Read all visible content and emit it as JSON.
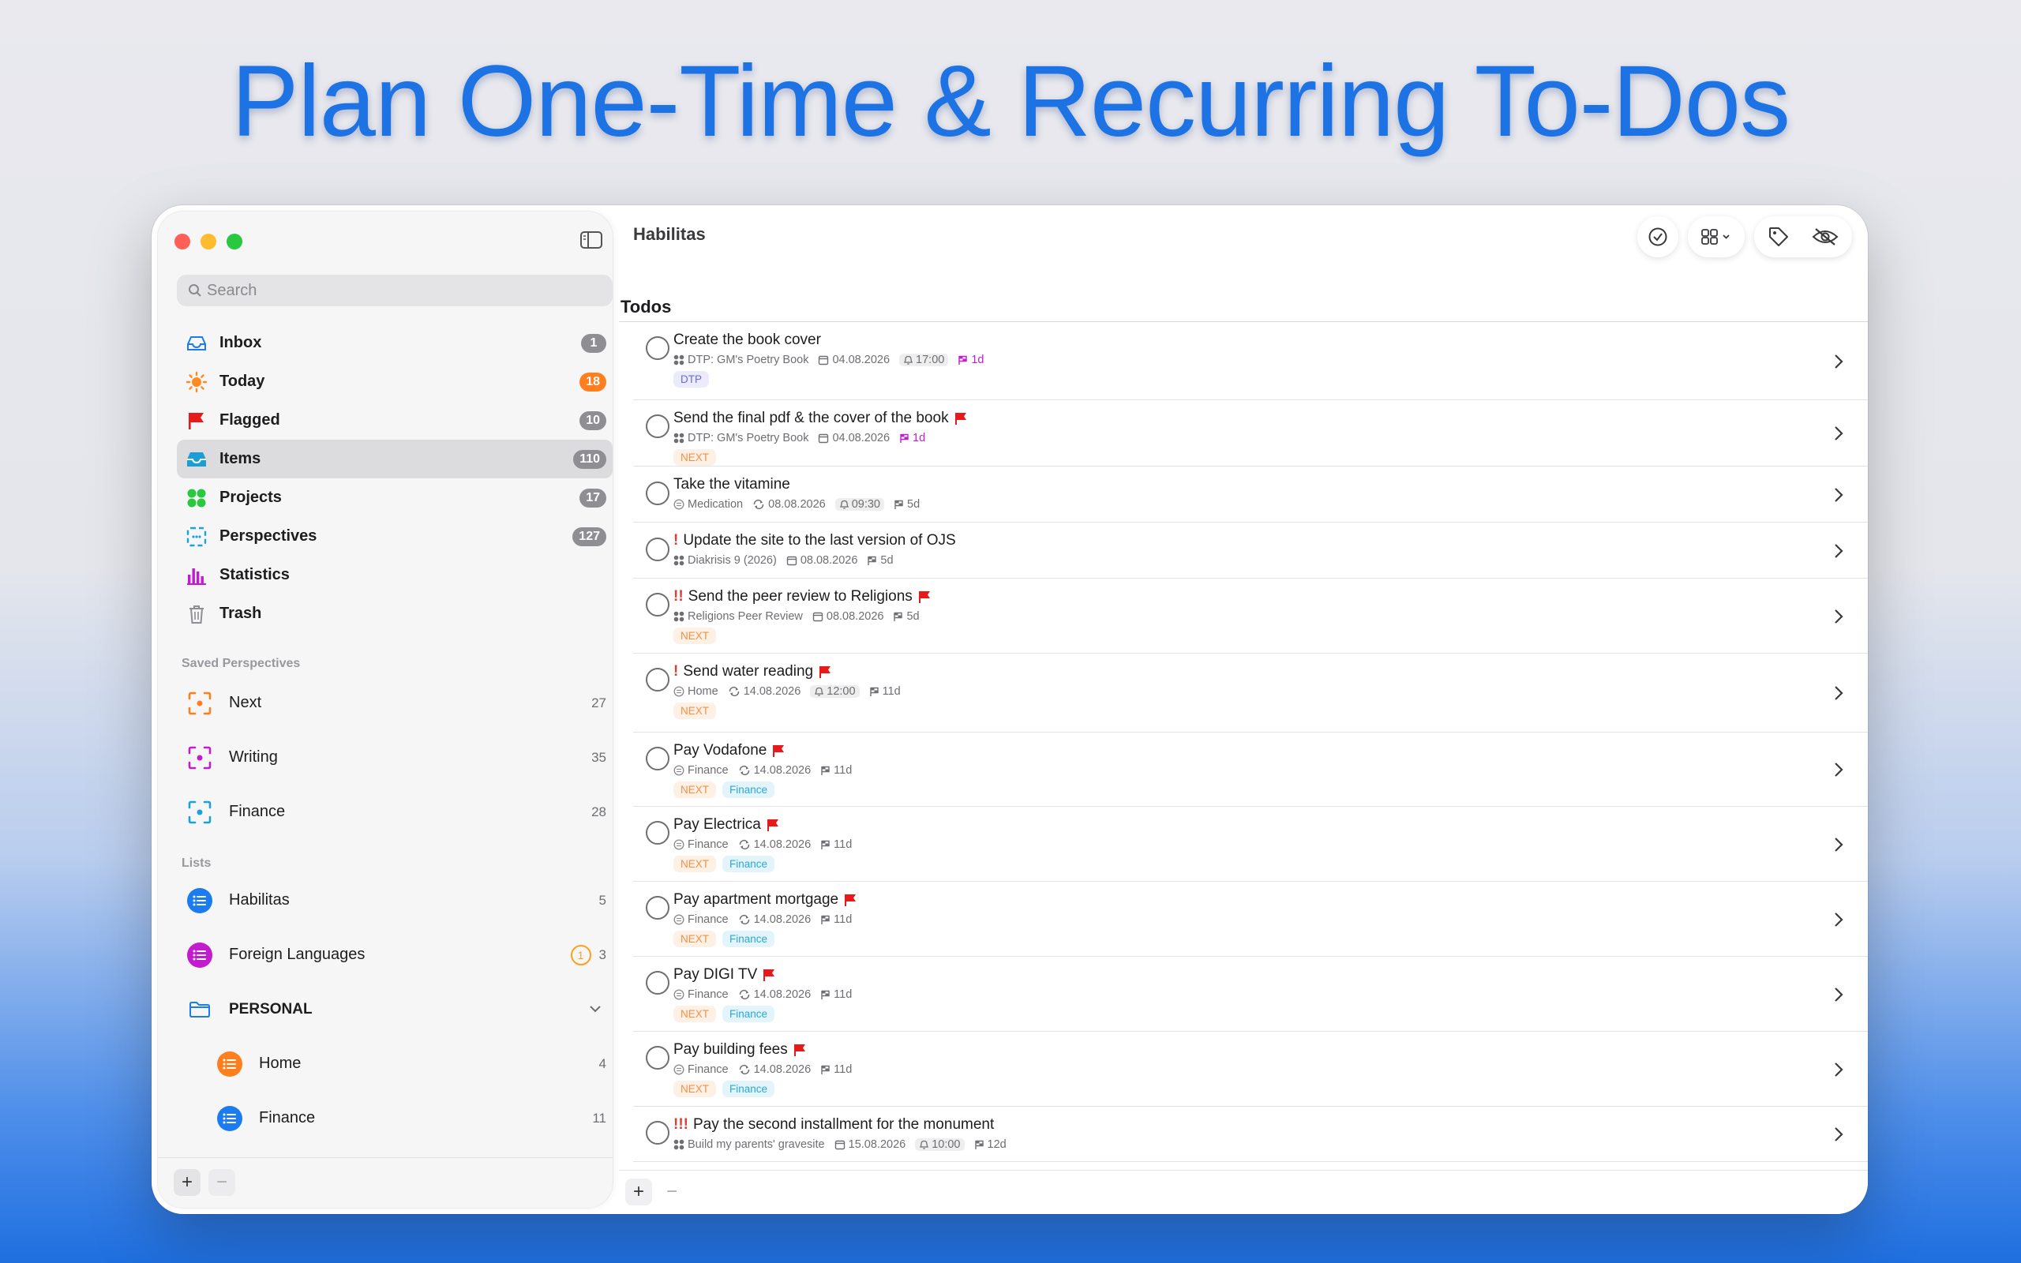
{
  "headline": "Plan One-Time & Recurring To-Dos",
  "sidebar": {
    "search_placeholder": "Search",
    "nav": [
      {
        "label": "Inbox",
        "count": "1"
      },
      {
        "label": "Today",
        "count": "18"
      },
      {
        "label": "Flagged",
        "count": "10"
      },
      {
        "label": "Items",
        "count": "110"
      },
      {
        "label": "Projects",
        "count": "17"
      },
      {
        "label": "Perspectives",
        "count": "127"
      },
      {
        "label": "Statistics"
      },
      {
        "label": "Trash"
      }
    ],
    "saved_title": "Saved Perspectives",
    "saved": [
      {
        "label": "Next",
        "count": "27",
        "color": "#ff7f1f"
      },
      {
        "label": "Writing",
        "count": "35",
        "color": "#c21bd0"
      },
      {
        "label": "Finance",
        "count": "28",
        "color": "#19a3d8"
      }
    ],
    "lists_title": "Lists",
    "lists": [
      {
        "label": "Habilitas",
        "count": "5",
        "color": "#1a7cf0"
      },
      {
        "label": "Foreign Languages",
        "count": "3",
        "alert": "1",
        "color": "#c21bd0"
      }
    ],
    "folder": {
      "label": "PERSONAL"
    },
    "sublists": [
      {
        "label": "Home",
        "count": "4",
        "color": "#ff7f1f"
      },
      {
        "label": "Finance",
        "count": "11",
        "color": "#1a7cf0"
      }
    ]
  },
  "main": {
    "title": "Habilitas",
    "section": "Todos",
    "tasks": [
      {
        "prio": "",
        "title": "Create the book cover",
        "flag": false,
        "project": "DTP: GM's Poetry Book",
        "ptype": "project",
        "date": "04.08.2026",
        "dtype": "cal",
        "time": "17:00",
        "due": "1d",
        "due_mag": true,
        "tags": [
          {
            "t": "DTP",
            "c": "dtp"
          }
        ]
      },
      {
        "prio": "",
        "title": "Send the final pdf & the cover of the book",
        "flag": true,
        "project": "DTP: GM's Poetry Book",
        "ptype": "project",
        "date": "04.08.2026",
        "dtype": "cal",
        "due": "1d",
        "due_mag": true,
        "tags": [
          {
            "t": "NEXT",
            "c": "next"
          }
        ]
      },
      {
        "prio": "",
        "title": "Take the vitamine",
        "flag": false,
        "project": "Medication",
        "ptype": "area",
        "date": "08.08.2026",
        "dtype": "rep",
        "time": "09:30",
        "due": "5d",
        "tags": []
      },
      {
        "prio": "!",
        "title": "Update the site to the last version of OJS",
        "flag": false,
        "project": "Diakrisis 9 (2026)",
        "ptype": "project",
        "date": "08.08.2026",
        "dtype": "cal",
        "due": "5d",
        "tags": []
      },
      {
        "prio": "!!",
        "title": "Send the peer review to Religions",
        "flag": true,
        "project": "Religions Peer Review",
        "ptype": "project",
        "date": "08.08.2026",
        "dtype": "cal",
        "due": "5d",
        "tags": [
          {
            "t": "NEXT",
            "c": "next"
          }
        ]
      },
      {
        "prio": "!",
        "title": "Send water reading",
        "flag": true,
        "project": "Home",
        "ptype": "area",
        "date": "14.08.2026",
        "dtype": "rep",
        "time": "12:00",
        "due": "11d",
        "tags": [
          {
            "t": "NEXT",
            "c": "next"
          }
        ]
      },
      {
        "prio": "",
        "title": "Pay Vodafone",
        "flag": true,
        "project": "Finance",
        "ptype": "area",
        "date": "14.08.2026",
        "dtype": "rep",
        "due": "11d",
        "tags": [
          {
            "t": "NEXT",
            "c": "next"
          },
          {
            "t": "Finance",
            "c": "fin"
          }
        ]
      },
      {
        "prio": "",
        "title": "Pay Electrica",
        "flag": true,
        "project": "Finance",
        "ptype": "area",
        "date": "14.08.2026",
        "dtype": "rep",
        "due": "11d",
        "tags": [
          {
            "t": "NEXT",
            "c": "next"
          },
          {
            "t": "Finance",
            "c": "fin"
          }
        ]
      },
      {
        "prio": "",
        "title": "Pay apartment mortgage",
        "flag": true,
        "project": "Finance",
        "ptype": "area",
        "date": "14.08.2026",
        "dtype": "rep",
        "due": "11d",
        "tags": [
          {
            "t": "NEXT",
            "c": "next"
          },
          {
            "t": "Finance",
            "c": "fin"
          }
        ]
      },
      {
        "prio": "",
        "title": "Pay DIGI TV",
        "flag": true,
        "project": "Finance",
        "ptype": "area",
        "date": "14.08.2026",
        "dtype": "rep",
        "due": "11d",
        "tags": [
          {
            "t": "NEXT",
            "c": "next"
          },
          {
            "t": "Finance",
            "c": "fin"
          }
        ]
      },
      {
        "prio": "",
        "title": "Pay building fees",
        "flag": true,
        "project": "Finance",
        "ptype": "area",
        "date": "14.08.2026",
        "dtype": "rep",
        "due": "11d",
        "tags": [
          {
            "t": "NEXT",
            "c": "next"
          },
          {
            "t": "Finance",
            "c": "fin"
          }
        ]
      },
      {
        "prio": "!!!",
        "title": "Pay the second installment for the monument",
        "flag": false,
        "project": "Build my parents' gravesite",
        "ptype": "project",
        "date": "15.08.2026",
        "dtype": "cal",
        "time": "10:00",
        "due": "12d",
        "tags": []
      }
    ]
  }
}
